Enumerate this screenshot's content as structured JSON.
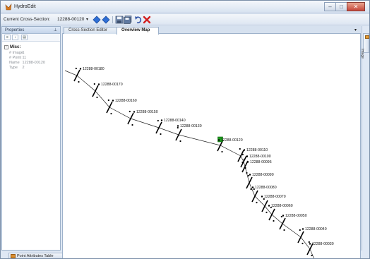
{
  "window": {
    "title": "HydroEdit"
  },
  "toolbar": {
    "current_cross_section_label": "Current Cross-Section:",
    "current_cross_section_value": "12288-00120"
  },
  "properties_panel": {
    "title": "Properties",
    "group_label": "Misc",
    "rows": [
      {
        "name": "# Image",
        "value": "1"
      },
      {
        "name": "# Point",
        "value": "11"
      },
      {
        "name": "Name",
        "value": "12288-00120"
      },
      {
        "name": "Type",
        "value": "2"
      }
    ]
  },
  "tabs": [
    {
      "label": "Cross-Section Editor",
      "selected": false
    },
    {
      "label": "Overview Map",
      "selected": true
    }
  ],
  "bottom_tab": {
    "label": "Point Attributes Table"
  },
  "right_sidebar": {
    "image_tab_label": "Image"
  },
  "map": {
    "selected_section": "12288-00120",
    "highlight_color": "#1e9b1e",
    "sections": [
      "12288-00180",
      "12288-00170",
      "12288-00160",
      "12288-00150",
      "12288-00140",
      "12288-00130",
      "12288-00120",
      "12288-00110",
      "12288-00100",
      "12288-00095",
      "12288-00090",
      "12288-00080",
      "12288-00070",
      "12288-00060",
      "12288-00050",
      "12288-00040",
      "12288-00030"
    ]
  },
  "colors": {
    "accent": "#2f6fd6",
    "delete": "#d21f1f",
    "title_bar": "#dbe5f2"
  }
}
